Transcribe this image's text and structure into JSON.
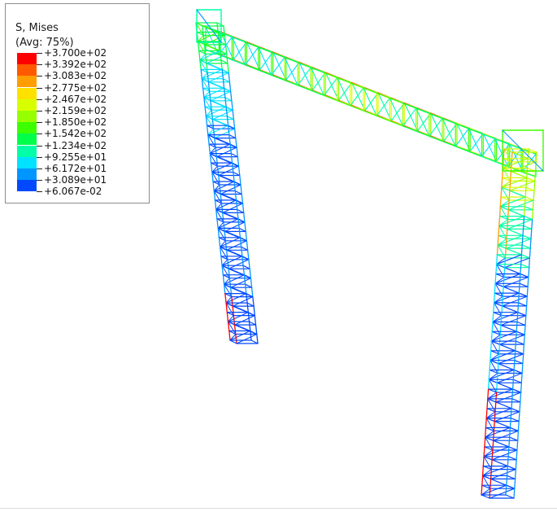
{
  "legend": {
    "title_line1": "S, Mises",
    "title_line2": "(Avg: 75%)",
    "labels": [
      "+3.700e+02",
      "+3.392e+02",
      "+3.083e+02",
      "+2.775e+02",
      "+2.467e+02",
      "+2.159e+02",
      "+1.850e+02",
      "+1.542e+02",
      "+1.234e+02",
      "+9.255e+01",
      "+6.172e+01",
      "+3.089e+01",
      "+6.067e-02"
    ],
    "colors": [
      "#ff0000",
      "#ff5a00",
      "#ff9e00",
      "#ffe100",
      "#d8ff00",
      "#96ff00",
      "#3cff00",
      "#00ff49",
      "#00ffa6",
      "#00e2ff",
      "#0096ff",
      "#0049ff"
    ]
  }
}
